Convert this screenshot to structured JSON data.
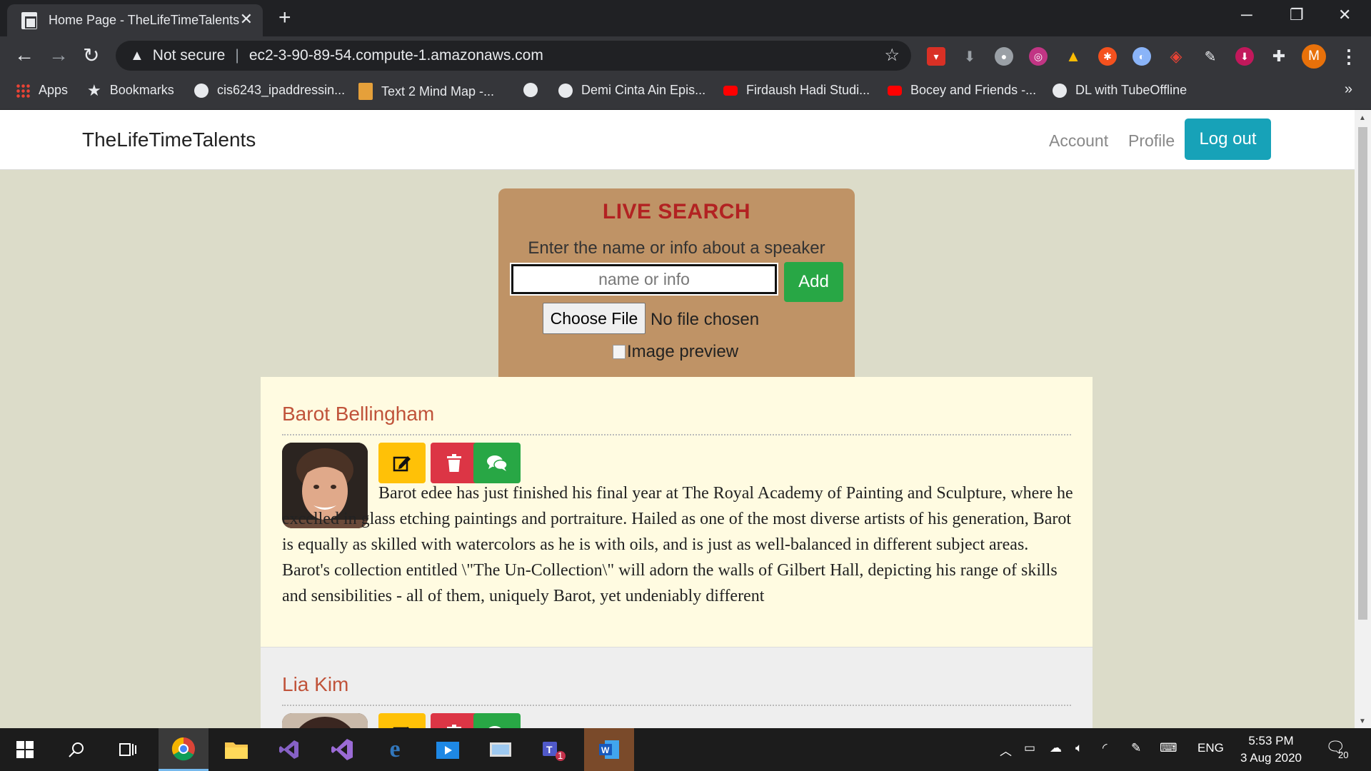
{
  "browser": {
    "tab_title": "Home Page - TheLifeTimeTalents",
    "tab_close": "✕",
    "new_tab": "+",
    "security": "Not secure",
    "url": "ec2-3-90-89-54.compute-1.amazonaws.com",
    "profile_initial": "M",
    "bookmarks": [
      {
        "label": "Apps",
        "icon": "apps-grid-icon"
      },
      {
        "label": "Bookmarks",
        "icon": "star-icon"
      },
      {
        "label": "cis6243_ipaddressin...",
        "icon": "globe-icon"
      },
      {
        "label": "Text 2 Mind Map -...",
        "icon": "text-icon"
      },
      {
        "label": "",
        "icon": "globe-icon"
      },
      {
        "label": "Demi Cinta Ain Epis...",
        "icon": "globe-icon"
      },
      {
        "label": "Firdaush Hadi Studi...",
        "icon": "youtube-icon"
      },
      {
        "label": "Bocey and Friends -...",
        "icon": "youtube-icon"
      },
      {
        "label": "DL with TubeOffline",
        "icon": "globe-icon"
      }
    ],
    "more": "»"
  },
  "navbar": {
    "brand": "TheLifeTimeTalents",
    "account": "Account",
    "profile": "Profile",
    "logout": "Log out"
  },
  "search": {
    "title": "LIVE SEARCH",
    "hint": "Enter the name or info about a speaker",
    "placeholder": "name or info",
    "add_label": "Add",
    "choose_file": "Choose File",
    "no_file": "No file chosen",
    "preview_alt": "Image preview"
  },
  "speakers": [
    {
      "name": "Barot Bellingham",
      "bio": "Barot edee has just finished his final year at The Royal Academy of Painting and Sculpture, where he excelled in glass etching paintings and portraiture. Hailed as one of the most diverse artists of his generation, Barot is equally as skilled with watercolors as he is with oils, and is just as well-balanced in different subject areas. Barot's collection entitled \\\"The Un-Collection\\\" will adorn the walls of Gilbert Hall, depicting his range of skills and sensibilities - all of them, uniquely Barot, yet undeniably different"
    },
    {
      "name": "Lia Kim",
      "bio": ""
    }
  ],
  "taskbar": {
    "language": "ENG",
    "time": "5:53 PM",
    "date": "3 Aug 2020",
    "notifications": "20",
    "teams_badge": "1"
  },
  "colors": {
    "page_bg": "#dcdcc9",
    "search_bg": "#bf9366",
    "title_red": "#b22222",
    "name_color": "#c0533a",
    "edit_yellow": "#ffc107",
    "delete_red": "#dc3545",
    "chat_green": "#28a745",
    "logout_teal": "#17a2b8"
  }
}
